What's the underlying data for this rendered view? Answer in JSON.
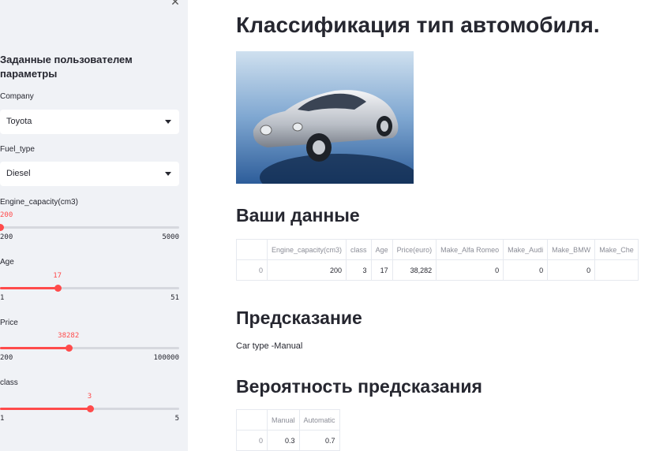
{
  "sidebar": {
    "close_icon": "✕",
    "title": "Заданные пользователем параметры",
    "company": {
      "label": "Company",
      "value": "Toyota"
    },
    "fuel_type": {
      "label": "Fuel_type",
      "value": "Diesel"
    },
    "sliders": [
      {
        "label": "Engine_capacity(cm3)",
        "value": "200",
        "min": "200",
        "max": "5000",
        "fraction": 0.0
      },
      {
        "label": "Age",
        "value": "17",
        "min": "1",
        "max": "51",
        "fraction": 0.32
      },
      {
        "label": "Price",
        "value": "38282",
        "min": "200",
        "max": "100000",
        "fraction": 0.382
      },
      {
        "label": "class",
        "value": "3",
        "min": "1",
        "max": "5",
        "fraction": 0.5
      }
    ]
  },
  "main": {
    "title": "Классификация тип автомобиля.",
    "data_heading": "Ваши данные",
    "data_table": {
      "columns": [
        "",
        "Engine_capacity(cm3)",
        "class",
        "Age",
        "Price(euro)",
        "Make_Alfa Romeo",
        "Make_Audi",
        "Make_BMW",
        "Make_Che"
      ],
      "rows": [
        [
          "0",
          "200",
          "3",
          "17",
          "38,282",
          "0",
          "0",
          "0",
          ""
        ]
      ]
    },
    "prediction_heading": "Предсказание",
    "prediction_text": "Car type -Manual",
    "probability_heading": "Вероятность предсказания",
    "prob_table": {
      "columns": [
        "",
        "Manual",
        "Automatic"
      ],
      "rows": [
        [
          "0",
          "0.3",
          "0.7"
        ]
      ]
    }
  },
  "colors": {
    "accent": "#ff4b4b",
    "sidebar_bg": "#f0f2f6",
    "text": "#262730"
  }
}
